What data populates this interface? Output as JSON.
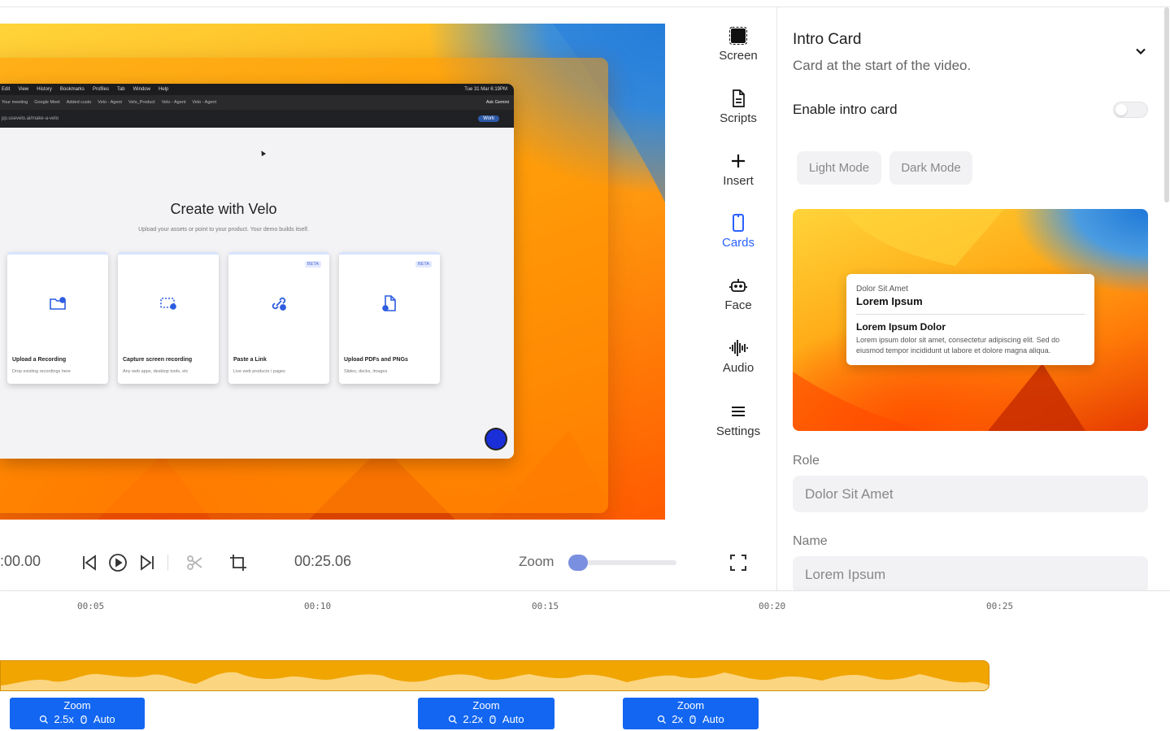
{
  "preview": {
    "menubar": [
      "Edit",
      "View",
      "History",
      "Bookmarks",
      "Profiles",
      "Tab",
      "Window",
      "Help"
    ],
    "menubar_right": "Tue 31 Mar  6:19PM",
    "tabs": [
      "Your meeting",
      "Google Meet",
      "Added custo",
      "Velo - Agent",
      "Velo_Product",
      "Velo - Agent",
      "Velo - Agent"
    ],
    "ask_gemini": "Ask Gemini",
    "url": "pp.usevelo.ai/make-a-velo",
    "work_badge": "Work",
    "heading": "Create with Velo",
    "subheading": "Upload your assets or point to your product. Your demo builds itself.",
    "cards": [
      {
        "title": "Upload a Recording",
        "desc": "Drop existing recordings here",
        "beta": ""
      },
      {
        "title": "Capture screen recording",
        "desc": "Any web apps, desktop tools, etc",
        "beta": ""
      },
      {
        "title": "Paste a Link",
        "desc": "Live web products / pages",
        "beta": "BETA"
      },
      {
        "title": "Upload PDFs and PNGs",
        "desc": "Slides, decks, images",
        "beta": "BETA"
      }
    ]
  },
  "controls": {
    "current_time": ":00.00",
    "duration": "00:25.06",
    "zoom_label": "Zoom",
    "zoom_level": 0.0
  },
  "tools": [
    {
      "label": "Screen",
      "icon": "screen-icon"
    },
    {
      "label": "Scripts",
      "icon": "document-icon"
    },
    {
      "label": "Insert",
      "icon": "plus-icon"
    },
    {
      "label": "Cards",
      "icon": "phone-card-icon"
    },
    {
      "label": "Face",
      "icon": "robot-face-icon"
    },
    {
      "label": "Audio",
      "icon": "waveform-icon"
    },
    {
      "label": "Settings",
      "icon": "menu-icon"
    }
  ],
  "panel": {
    "title": "Intro Card",
    "subtitle": "Card at the start of the video.",
    "enable_label": "Enable intro card",
    "enabled": false,
    "modes": [
      "Light Mode",
      "Dark Mode"
    ],
    "card_preview": {
      "role": "Dolor Sit Amet",
      "name": "Lorem Ipsum",
      "headline": "Lorem Ipsum Dolor",
      "body": "Lorem ipsum dolor sit amet, consectetur adipiscing elit. Sed do eiusmod tempor incididunt ut labore et dolore magna aliqua."
    },
    "role_label": "Role",
    "role_placeholder": "Dolor Sit Amet",
    "name_label": "Name",
    "name_placeholder": "Lorem Ipsum"
  },
  "timeline": {
    "ticks": [
      "00:05",
      "00:10",
      "00:15",
      "00:20",
      "00:25"
    ],
    "zoom_segments": [
      {
        "title": "Zoom",
        "level": "2.5x",
        "mode": "Auto"
      },
      {
        "title": "Zoom",
        "level": "2.2x",
        "mode": "Auto"
      },
      {
        "title": "Zoom",
        "level": "2x",
        "mode": "Auto"
      }
    ]
  },
  "colors": {
    "accent": "#2962ff",
    "zoom_segment": "#1266f1",
    "audio_track": "#f0a500",
    "audio_wave": "#fcd580"
  }
}
